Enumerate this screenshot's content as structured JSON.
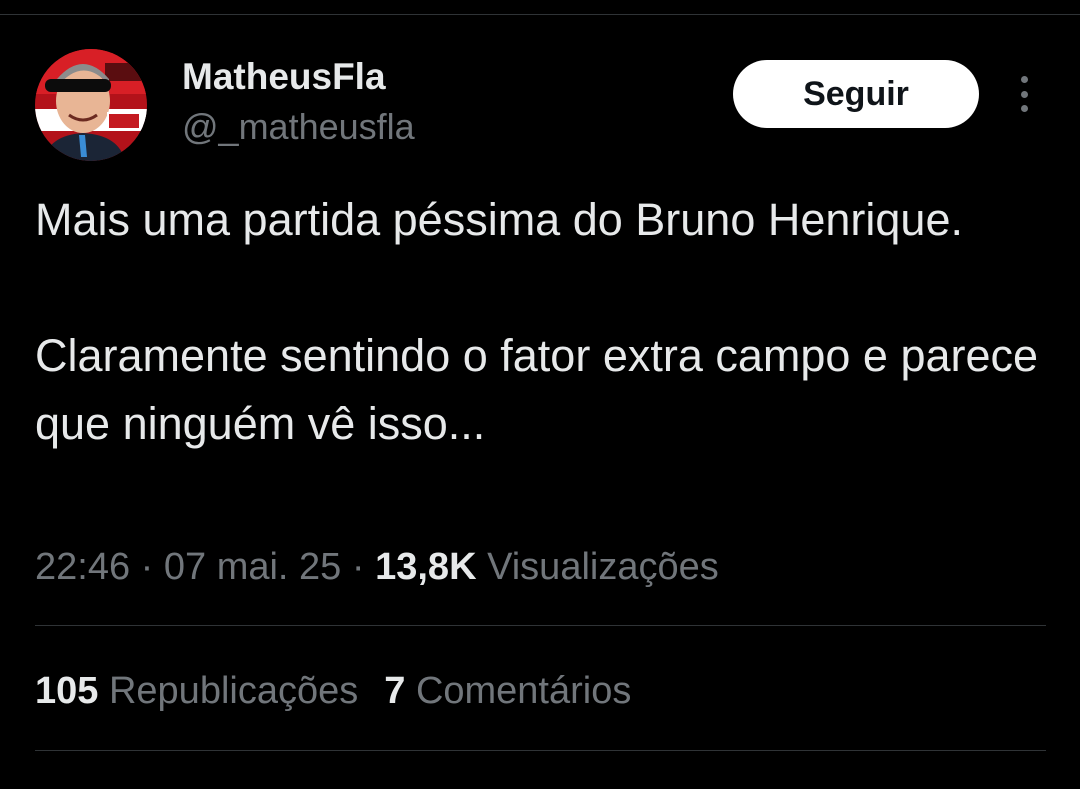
{
  "author": {
    "display_name": "MatheusFla",
    "handle": "@_matheusfla",
    "avatar_icon": "profile-photo"
  },
  "follow_button": {
    "label": "Seguir"
  },
  "more_menu": {
    "icon": "more-vertical-icon"
  },
  "tweet": {
    "paragraphs": [
      "Mais uma partida péssima do Bruno Henrique.",
      "Claramente sentindo o fator extra campo e parece que ninguém vê isso..."
    ]
  },
  "meta": {
    "time": "22:46",
    "separator": " · ",
    "date": "07 mai. 25",
    "views_count": "13,8K",
    "views_label": "Visualizações"
  },
  "stats": {
    "reposts_count": "105",
    "reposts_label": "Republicações",
    "comments_count": "7",
    "comments_label": "Comentários"
  },
  "colors": {
    "background": "#000000",
    "primary_text": "#e7e9ea",
    "secondary_text": "#71767b",
    "divider": "#2f3336",
    "button_bg": "#ffffff"
  }
}
